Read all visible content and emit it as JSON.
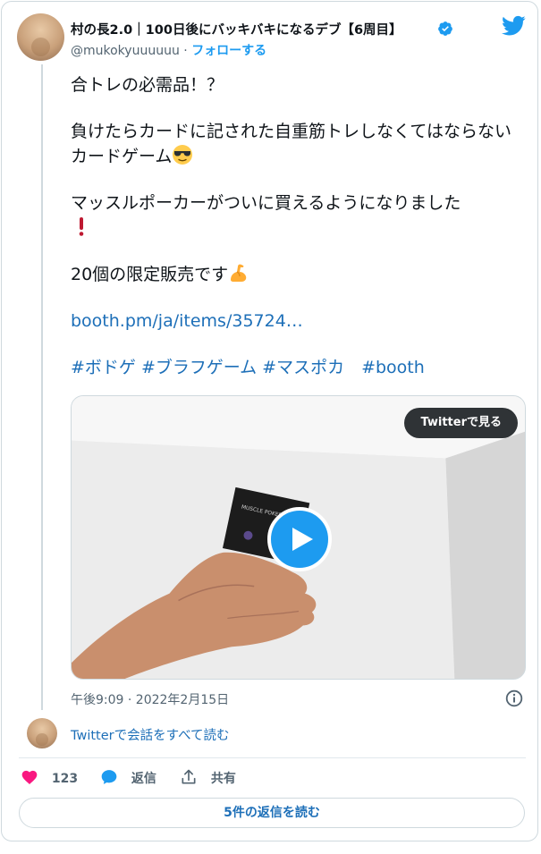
{
  "author": {
    "display_name": "村の長2.0｜100日後にバッキバキになるデブ【6周目】",
    "handle": "@mukokyuuuuuu",
    "separator": " · ",
    "follow_label": "フォローする"
  },
  "tweet": {
    "line1": "合トレの必需品！？",
    "line2": "負けたらカードに記された自重筋トレしなくてはならないカードゲーム",
    "line3": "マッスルポーカーがついに買えるようになりました",
    "line4": "20個の限定販売です",
    "link": "booth.pm/ja/items/35724…",
    "hashtags": "#ボドゲ #ブラフゲーム #マスポカ　#booth"
  },
  "media": {
    "watch_label": "Twitterで見る",
    "card_text": "MUSCLE POKER"
  },
  "timestamp": "午後9:09 · 2022年2月15日",
  "read_conversation": "Twitterで会話をすべて読む",
  "actions": {
    "like_count": "123",
    "reply_label": "返信",
    "share_label": "共有"
  },
  "replies_button": "5件の返信を読む",
  "colors": {
    "accent": "#1d9bf0",
    "like": "#f91880",
    "link": "#1d6fb8",
    "secondary_text": "#536471"
  }
}
